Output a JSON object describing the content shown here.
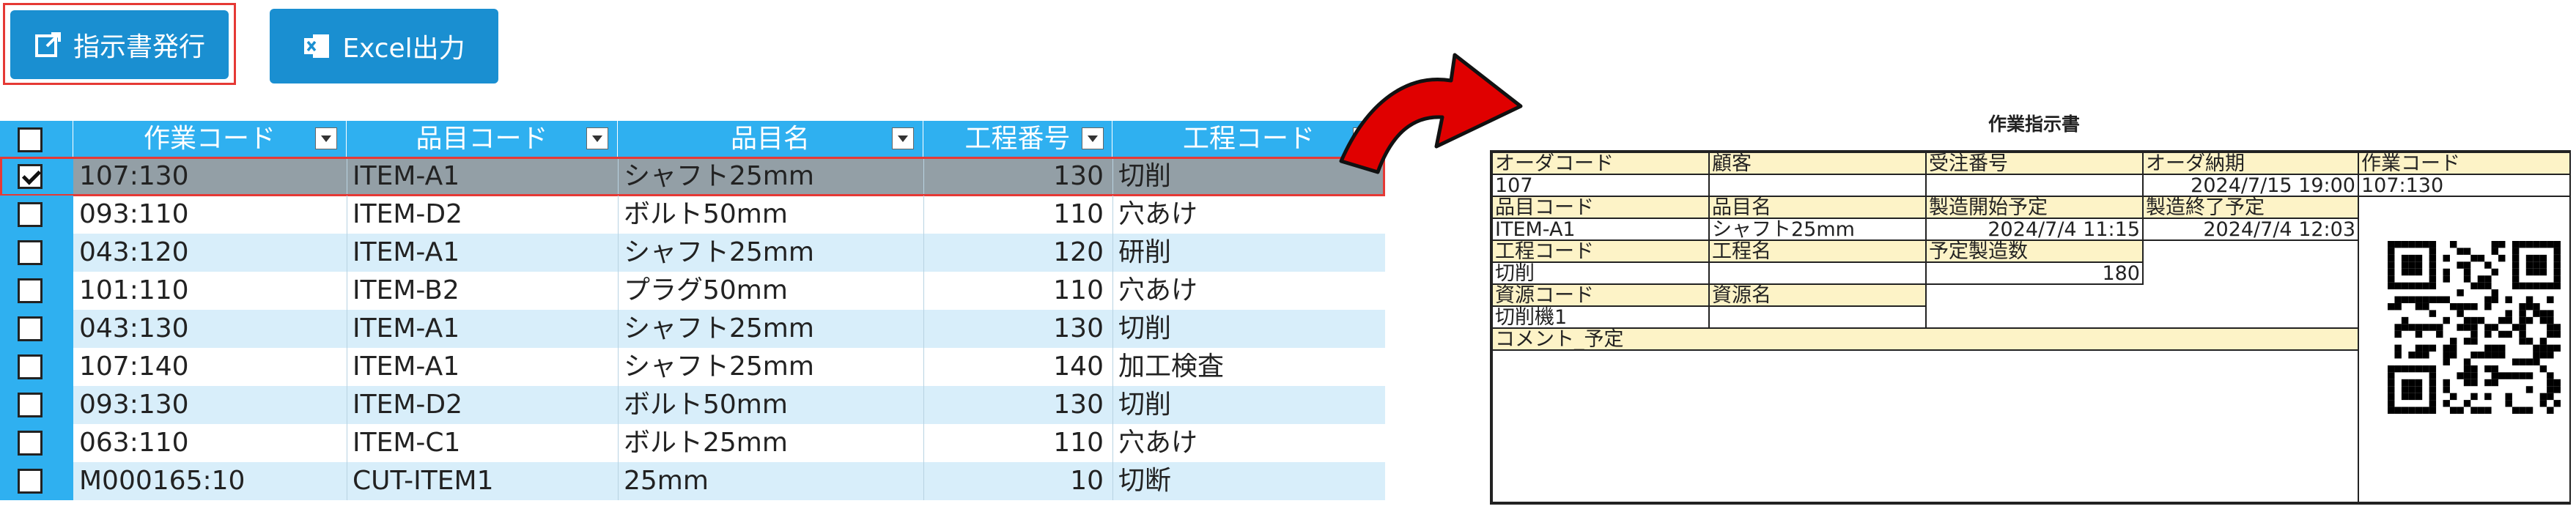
{
  "toolbar": {
    "issue_label": "指示書発行",
    "excel_label": "Excel出力"
  },
  "grid": {
    "columns": [
      "作業コード",
      "品目コード",
      "品目名",
      "工程番号",
      "工程コード"
    ],
    "rows": [
      {
        "checked": true,
        "work_code": "107:130",
        "item_code": "ITEM-A1",
        "item_name": "シャフト25mm",
        "process_no": "130",
        "process_code": "切削"
      },
      {
        "checked": false,
        "work_code": "093:110",
        "item_code": "ITEM-D2",
        "item_name": "ボルト50mm",
        "process_no": "110",
        "process_code": "穴あけ"
      },
      {
        "checked": false,
        "work_code": "043:120",
        "item_code": "ITEM-A1",
        "item_name": "シャフト25mm",
        "process_no": "120",
        "process_code": "研削"
      },
      {
        "checked": false,
        "work_code": "101:110",
        "item_code": "ITEM-B2",
        "item_name": "プラグ50mm",
        "process_no": "110",
        "process_code": "穴あけ"
      },
      {
        "checked": false,
        "work_code": "043:130",
        "item_code": "ITEM-A1",
        "item_name": "シャフト25mm",
        "process_no": "130",
        "process_code": "切削"
      },
      {
        "checked": false,
        "work_code": "107:140",
        "item_code": "ITEM-A1",
        "item_name": "シャフト25mm",
        "process_no": "140",
        "process_code": "加工検査"
      },
      {
        "checked": false,
        "work_code": "093:130",
        "item_code": "ITEM-D2",
        "item_name": "ボルト50mm",
        "process_no": "130",
        "process_code": "切削"
      },
      {
        "checked": false,
        "work_code": "063:110",
        "item_code": "ITEM-C1",
        "item_name": "ボルト25mm",
        "process_no": "110",
        "process_code": "穴あけ"
      },
      {
        "checked": false,
        "work_code": "M000165:10",
        "item_code": "CUT-ITEM1",
        "item_name": "25mm",
        "process_no": "10",
        "process_code": "切断"
      }
    ]
  },
  "doc": {
    "title": "作業指示書",
    "labels": {
      "order_code": "オーダコード",
      "customer": "顧客",
      "order_no": "受注番号",
      "due": "オーダ納期",
      "work_code": "作業コード",
      "item_code": "品目コード",
      "item_name": "品目名",
      "start": "製造開始予定",
      "end": "製造終了予定",
      "process_code": "工程コード",
      "process_name": "工程名",
      "qty": "予定製造数",
      "resource_code": "資源コード",
      "resource_name": "資源名",
      "comment": "コメント_予定"
    },
    "values": {
      "order_code": "107",
      "customer": "",
      "order_no": "",
      "due": "2024/7/15 19:00",
      "work_code": "107:130",
      "item_code": "ITEM-A1",
      "item_name": "シャフト25mm",
      "start": "2024/7/4 11:15",
      "end": "2024/7/4 12:03",
      "process_code": "切削",
      "process_name": "",
      "qty": "180",
      "resource_code": "切削機1",
      "resource_name": "",
      "comment": ""
    }
  },
  "colors": {
    "button": "#1a8fd1",
    "header": "#2fb0f0",
    "row_alt": "#d8eefa",
    "row_selected": "#939fa6",
    "highlight_border": "#e53935",
    "label_bg": "#fdf3c7",
    "arrow": "#e00000"
  },
  "icons": {
    "issue": "external-link-icon",
    "excel": "excel-icon",
    "filter": "filter-dropdown-icon",
    "qr": "qr-code-icon"
  }
}
